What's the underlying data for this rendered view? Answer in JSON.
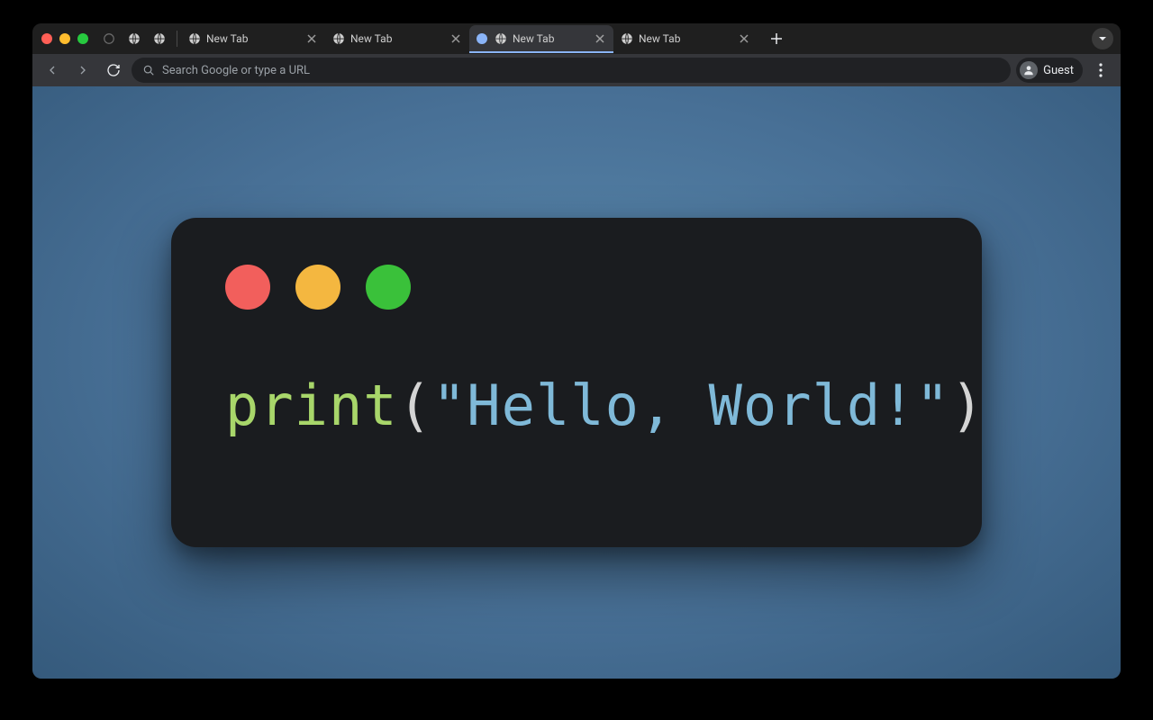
{
  "tabs": [
    {
      "title": "New Tab"
    },
    {
      "title": "New Tab"
    },
    {
      "title": "New Tab"
    },
    {
      "title": "New Tab"
    }
  ],
  "active_tab_index": 2,
  "omnibox": {
    "placeholder": "Search Google or type a URL"
  },
  "profile": {
    "label": "Guest"
  },
  "page": {
    "code": {
      "fn": "print",
      "open": "(",
      "string": "\"Hello, World!\"",
      "close": ")"
    },
    "window_dot_colors": {
      "red": "#f25f5c",
      "yellow": "#f4b740",
      "green": "#3ac13a"
    }
  }
}
